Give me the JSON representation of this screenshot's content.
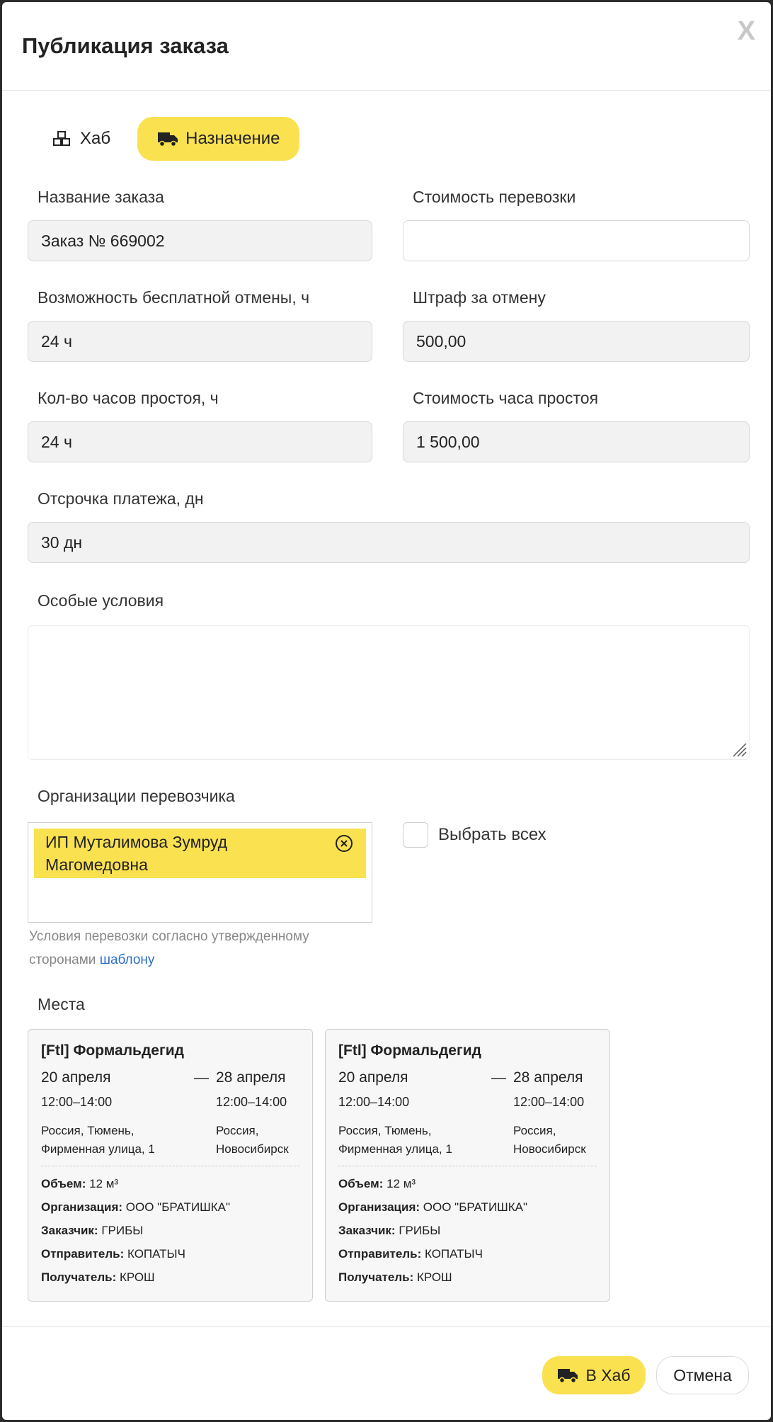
{
  "modal": {
    "title": "Публикация заказа",
    "close_label": "X"
  },
  "tabs": [
    {
      "label": "Хаб",
      "icon": "boxes-icon",
      "active": false
    },
    {
      "label": "Назначение",
      "icon": "truck-icon",
      "active": true
    }
  ],
  "form": {
    "order_name": {
      "label": "Название заказа",
      "value": "Заказ № 669002"
    },
    "transport_cost": {
      "label": "Стоимость перевозки",
      "value": ""
    },
    "free_cancel": {
      "label": "Возможность бесплатной отмены, ч",
      "value": "24 ч"
    },
    "cancel_penalty": {
      "label": "Штраф за отмену",
      "value": "500,00"
    },
    "idle_hours": {
      "label": "Кол-во часов простоя, ч",
      "value": "24 ч"
    },
    "idle_hour_cost": {
      "label": "Стоимость часа простоя",
      "value": "1 500,00"
    },
    "payment_delay": {
      "label": "Отсрочка платежа, дн",
      "value": "30 дн"
    },
    "special_conditions": {
      "label": "Особые условия",
      "value": ""
    },
    "carrier_orgs": {
      "label": "Организации перевозчика",
      "selected": [
        "ИП Муталимова Зумруд",
        "Магомедовна"
      ]
    },
    "select_all_label": "Выбрать всех",
    "hint_text": "Условия перевозки согласно утвержденному сторонами",
    "hint_link": "шаблону"
  },
  "places": {
    "title": "Места",
    "cards": [
      {
        "title": "[Ftl] Формальдегид",
        "from_date": "20 апреля",
        "from_time": "12:00–14:00",
        "from_addr_1": "Россия, Тюмень,",
        "from_addr_2": "Фирменная улица, 1",
        "dash": "—",
        "to_date": "28 апреля",
        "to_time": "12:00–14:00",
        "to_addr_1": "Россия,",
        "to_addr_2": "Новосибирск",
        "volume_label": "Объем:",
        "volume": "12 м³",
        "org_label": "Организация:",
        "org": "ООО \"БРАТИШКА\"",
        "customer_label": "Заказчик:",
        "customer": "ГРИБЫ",
        "sender_label": "Отправитель:",
        "sender": "КОПАТЫЧ",
        "receiver_label": "Получатель:",
        "receiver": "КРОШ"
      },
      {
        "title": "[Ftl] Формальдегид",
        "from_date": "20 апреля",
        "from_time": "12:00–14:00",
        "from_addr_1": "Россия, Тюмень,",
        "from_addr_2": "Фирменная улица, 1",
        "dash": "—",
        "to_date": "28 апреля",
        "to_time": "12:00–14:00",
        "to_addr_1": "Россия,",
        "to_addr_2": "Новосибирск",
        "volume_label": "Объем:",
        "volume": "12 м³",
        "org_label": "Организация:",
        "org": "ООО \"БРАТИШКА\"",
        "customer_label": "Заказчик:",
        "customer": "ГРИБЫ",
        "sender_label": "Отправитель:",
        "sender": "КОПАТЫЧ",
        "receiver_label": "Получатель:",
        "receiver": "КРОШ"
      }
    ]
  },
  "footer": {
    "hub_button": "В Хаб",
    "cancel_button": "Отмена"
  },
  "colors": {
    "accent": "#fae150",
    "link": "#2f6ec7"
  }
}
